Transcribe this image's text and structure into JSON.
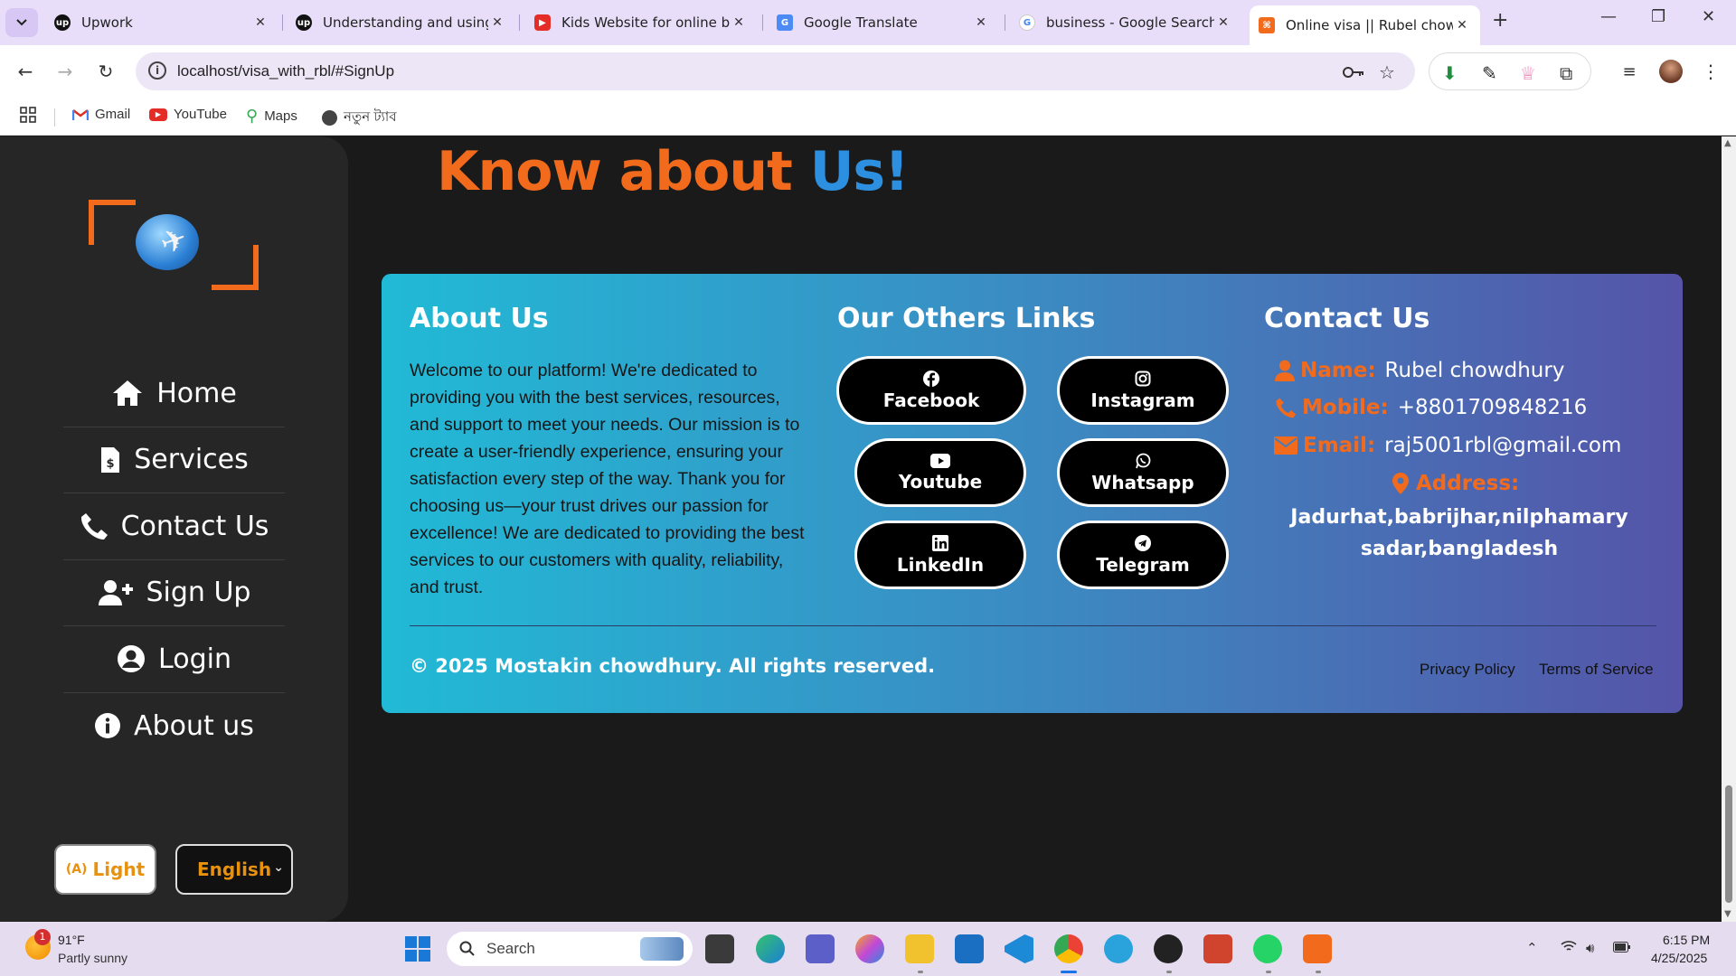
{
  "browser": {
    "tabs": [
      {
        "label": "Upwork",
        "favicon": "upwork-icon",
        "color": "#111111"
      },
      {
        "label": "Understanding and using C",
        "favicon": "upwork-icon",
        "color": "#111111"
      },
      {
        "label": "Kids Website for online bu",
        "favicon": "youtube-icon",
        "color": "#e52d27"
      },
      {
        "label": "Google Translate",
        "favicon": "google-translate-icon",
        "color": "#4c8bf5"
      },
      {
        "label": "business - Google Search",
        "favicon": "google-icon",
        "color": "#4285f4"
      },
      {
        "label": "Online visa || Rubel chowdl",
        "favicon": "site-icon",
        "color": "#f26b1d"
      }
    ],
    "url": "localhost/visa_with_rbl/#SignUp",
    "bookmarks": [
      {
        "label": "Gmail",
        "icon": "gmail-icon"
      },
      {
        "label": "YouTube",
        "icon": "youtube-icon"
      },
      {
        "label": "Maps",
        "icon": "maps-icon"
      },
      {
        "label": "নতুন ট্যাব",
        "icon": "globe-icon"
      }
    ]
  },
  "page": {
    "heading_part1": "Know about",
    "heading_part2": "Us!",
    "sidebar": {
      "items": [
        {
          "label": "Home",
          "icon": "home-icon"
        },
        {
          "label": "Services",
          "icon": "invoice-icon"
        },
        {
          "label": "Contact Us",
          "icon": "phone-icon"
        },
        {
          "label": "Sign Up",
          "icon": "user-plus-icon"
        },
        {
          "label": "Login",
          "icon": "user-circle-icon"
        },
        {
          "label": "About us",
          "icon": "info-icon"
        }
      ],
      "theme_button": "Light",
      "theme_icon": "(A)",
      "language": "English"
    },
    "footer": {
      "about_title": "About Us",
      "about_text": "Welcome to our platform! We're dedicated to providing you with the best services, resources, and support to meet your needs. Our mission is to create a user-friendly experience, ensuring your satisfaction every step of the way. Thank you for choosing us—your trust drives our passion for excellence! We are dedicated to providing the best services to our customers with quality, reliability, and trust.",
      "links_title": "Our Others Links",
      "links": [
        {
          "label": "Facebook",
          "icon": "facebook-icon"
        },
        {
          "label": "Instagram",
          "icon": "instagram-icon"
        },
        {
          "label": "Youtube",
          "icon": "youtube-icon"
        },
        {
          "label": "Whatsapp",
          "icon": "whatsapp-icon"
        },
        {
          "label": "LinkedIn",
          "icon": "linkedin-icon"
        },
        {
          "label": "Telegram",
          "icon": "telegram-icon"
        }
      ],
      "contact_title": "Contact Us",
      "contact": {
        "name_label": "Name:",
        "name": "Rubel chowdhury",
        "mobile_label": "Mobile:",
        "mobile": "+8801709848216",
        "email_label": "Email:",
        "email": "raj5001rbl@gmail.com",
        "address_label": "Address:",
        "address": "Jadurhat,babrijhar,nilphamary sadar,bangladesh"
      },
      "copyright": "© 2025 Mostakin chowdhury. All rights reserved.",
      "privacy": "Privacy Policy",
      "terms": "Terms of Service"
    },
    "colors": {
      "accent_orange": "#f26b1d",
      "accent_blue": "#2c8fe0",
      "footer_gradient_start": "#21bad6",
      "footer_gradient_end": "#5554a8"
    }
  },
  "taskbar": {
    "weather_temp": "91°F",
    "weather_desc": "Partly sunny",
    "weather_badge": "1",
    "search_placeholder": "Search",
    "time": "6:15 PM",
    "date": "4/25/2025"
  }
}
